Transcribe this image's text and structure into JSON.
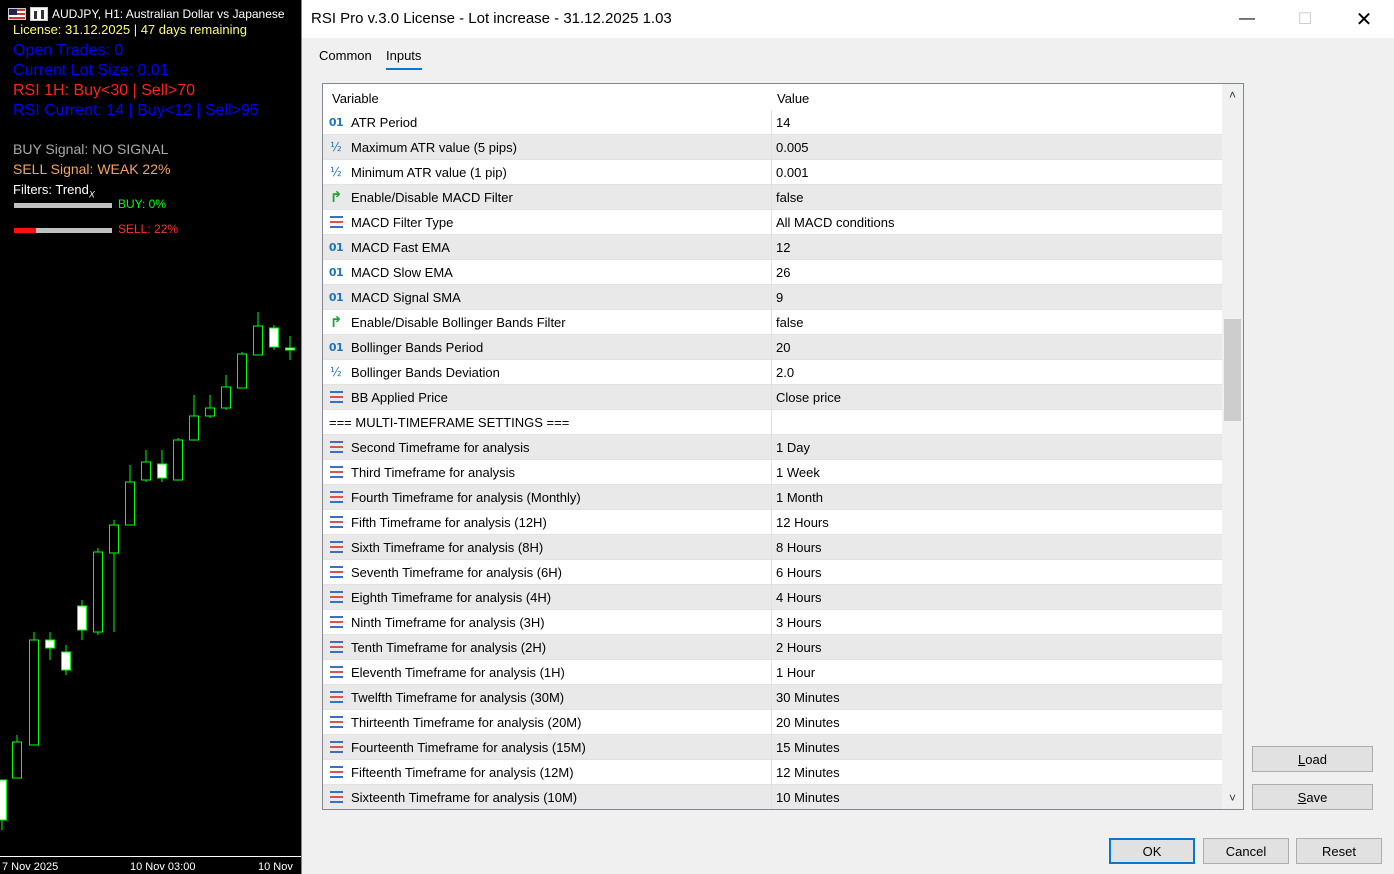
{
  "chart": {
    "symbol": "AUDJPY, H1:  Australian Dollar vs Japanese",
    "license": "License: 31.12.2025 | 47 days remaining",
    "open_trades": "Open Trades: 0",
    "lot_size": "Current Lot Size: 0.01",
    "rsi_1h": "RSI 1H: Buy<30 | Sell>70",
    "rsi_current": "RSI Current: 14 | Buy<12 | Sell>95",
    "buy_signal": "BUY Signal: NO SIGNAL",
    "sell_signal": "SELL Signal: WEAK 22%",
    "filters": "Filters: Trend",
    "filters_sub": "X",
    "buy_pct": "BUY: 0%",
    "buy_level": 0,
    "sell_pct": "SELL: 22%",
    "sell_level": 0.22,
    "time_labels": [
      "7 Nov 2025",
      "10 Nov 03:00",
      "10 Nov"
    ]
  },
  "dialog": {
    "title": "RSI Pro v.3.0 License - Lot increase - 31.12.2025 1.03",
    "tabs": [
      "Common",
      "Inputs"
    ],
    "active_tab": "Inputs",
    "header_variable": "Variable",
    "header_value": "Value",
    "rows": [
      {
        "icon": "int",
        "variable": "ATR Period",
        "value": "14"
      },
      {
        "icon": "double",
        "variable": "Maximum ATR value (5 pips)",
        "value": "0.005"
      },
      {
        "icon": "double",
        "variable": "Minimum ATR value (1 pip)",
        "value": "0.001"
      },
      {
        "icon": "bool",
        "variable": "Enable/Disable MACD Filter",
        "value": "false"
      },
      {
        "icon": "enum",
        "variable": "MACD Filter Type",
        "value": "All MACD conditions"
      },
      {
        "icon": "int",
        "variable": "MACD Fast EMA",
        "value": "12"
      },
      {
        "icon": "int",
        "variable": "MACD Slow EMA",
        "value": "26"
      },
      {
        "icon": "int",
        "variable": "MACD Signal SMA",
        "value": "9"
      },
      {
        "icon": "bool",
        "variable": "Enable/Disable Bollinger Bands Filter",
        "value": "false"
      },
      {
        "icon": "int",
        "variable": "Bollinger Bands Period",
        "value": "20"
      },
      {
        "icon": "double",
        "variable": "Bollinger Bands Deviation",
        "value": "2.0"
      },
      {
        "icon": "enum",
        "variable": "BB Applied Price",
        "value": "Close price"
      },
      {
        "icon": "",
        "variable": "=== MULTI-TIMEFRAME SETTINGS ===",
        "value": ""
      },
      {
        "icon": "enum",
        "variable": "Second Timeframe for analysis",
        "value": "1 Day"
      },
      {
        "icon": "enum",
        "variable": "Third Timeframe for analysis",
        "value": "1 Week"
      },
      {
        "icon": "enum",
        "variable": "Fourth Timeframe for analysis (Monthly)",
        "value": "1 Month"
      },
      {
        "icon": "enum",
        "variable": "Fifth Timeframe for analysis (12H)",
        "value": "12 Hours"
      },
      {
        "icon": "enum",
        "variable": "Sixth Timeframe for analysis (8H)",
        "value": "8 Hours"
      },
      {
        "icon": "enum",
        "variable": "Seventh Timeframe for analysis (6H)",
        "value": "6 Hours"
      },
      {
        "icon": "enum",
        "variable": "Eighth Timeframe for analysis (4H)",
        "value": "4 Hours"
      },
      {
        "icon": "enum",
        "variable": "Ninth Timeframe for analysis (3H)",
        "value": "3 Hours"
      },
      {
        "icon": "enum",
        "variable": "Tenth Timeframe for analysis (2H)",
        "value": "2 Hours"
      },
      {
        "icon": "enum",
        "variable": "Eleventh Timeframe for analysis (1H)",
        "value": "1 Hour"
      },
      {
        "icon": "enum",
        "variable": "Twelfth Timeframe for analysis (30M)",
        "value": "30 Minutes"
      },
      {
        "icon": "enum",
        "variable": "Thirteenth Timeframe for analysis (20M)",
        "value": "20 Minutes"
      },
      {
        "icon": "enum",
        "variable": "Fourteenth Timeframe for analysis (15M)",
        "value": "15 Minutes"
      },
      {
        "icon": "enum",
        "variable": "Fifteenth Timeframe for analysis (12M)",
        "value": "12 Minutes"
      },
      {
        "icon": "enum",
        "variable": "Sixteenth Timeframe for analysis (10M)",
        "value": "10 Minutes"
      }
    ],
    "buttons": {
      "load_u": "L",
      "load_rest": "oad",
      "save_u": "S",
      "save_rest": "ave",
      "ok": "OK",
      "cancel": "Cancel",
      "reset": "Reset"
    }
  }
}
